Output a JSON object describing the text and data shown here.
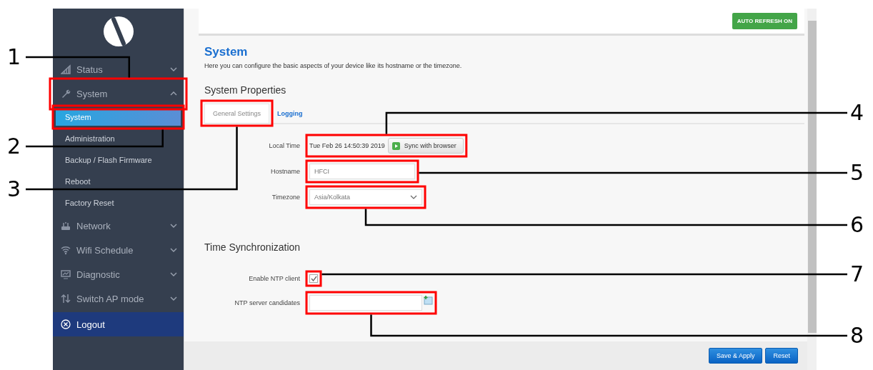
{
  "sidebar": {
    "items": [
      {
        "label": "Status",
        "expanded": false
      },
      {
        "label": "System",
        "expanded": true,
        "callout": "1",
        "children": [
          {
            "label": "System",
            "selected": true,
            "callout": "2"
          },
          {
            "label": "Administration",
            "selected": false
          },
          {
            "label": "Backup / Flash Firmware",
            "selected": false
          },
          {
            "label": "Reboot",
            "selected": false
          },
          {
            "label": "Factory Reset",
            "selected": false
          }
        ]
      },
      {
        "label": "Network",
        "expanded": false
      },
      {
        "label": "Wifi Schedule",
        "expanded": false
      },
      {
        "label": "Diagnostic",
        "expanded": false
      },
      {
        "label": "Switch AP mode",
        "expanded": false
      }
    ],
    "logout": {
      "label": "Logout"
    }
  },
  "toolbar": {
    "auto_refresh": "AUTO REFRESH ON"
  },
  "page": {
    "title": "System",
    "description": "Here you can configure the basic aspects of your device like its hostname or the timezone.",
    "section": "System Properties"
  },
  "tabs": [
    {
      "label": "General Settings",
      "selected": true,
      "callout": "3"
    },
    {
      "label": "Logging",
      "selected": false
    }
  ],
  "fields": [
    {
      "kind": "time",
      "label": "Local Time",
      "value": "Tue Feb 26 14:50:39 2019",
      "button": "Sync with browser",
      "callout": "4"
    },
    {
      "kind": "text",
      "label": "Hostname",
      "value": "HFCI",
      "callout": "5"
    },
    {
      "kind": "select",
      "label": "Timezone",
      "value": "Asia/Kolkata",
      "callout": "6"
    }
  ],
  "time_sync": {
    "heading": "Time Synchronization",
    "fields": [
      {
        "kind": "checkbox",
        "label": "Enable NTP client",
        "checked": true,
        "callout": "7"
      },
      {
        "kind": "list",
        "label": "NTP server candidates",
        "callout": "8"
      }
    ]
  },
  "buttons": [
    {
      "label": "Save & Apply"
    },
    {
      "label": "Reset"
    }
  ]
}
